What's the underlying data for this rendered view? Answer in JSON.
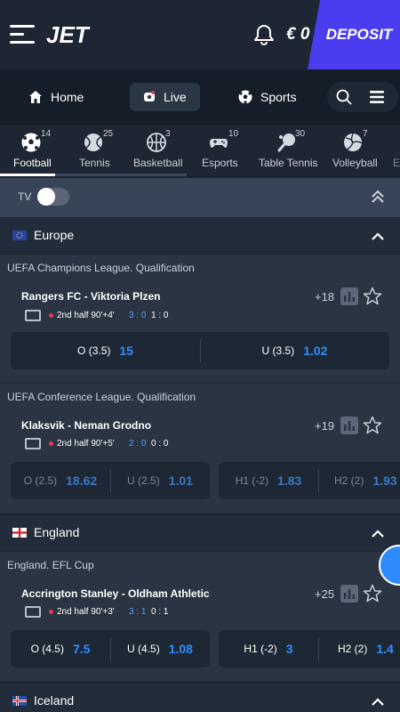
{
  "header": {
    "logo": "JET",
    "balance": "€ 0",
    "deposit": "DEPOSIT"
  },
  "nav": {
    "home": "Home",
    "live": "Live",
    "sports": "Sports"
  },
  "sports": [
    {
      "label": "Football",
      "count": "14",
      "icon": "football-icon"
    },
    {
      "label": "Tennis",
      "count": "25",
      "icon": "tennis-icon"
    },
    {
      "label": "Basketball",
      "count": "3",
      "icon": "basketball-icon"
    },
    {
      "label": "Esports",
      "count": "10",
      "icon": "gamepad-icon"
    },
    {
      "label": "Table Tennis",
      "count": "30",
      "icon": "table-tennis-icon"
    },
    {
      "label": "Volleyball",
      "count": "7",
      "icon": "volleyball-icon"
    },
    {
      "label": "E",
      "count": "",
      "icon": ""
    }
  ],
  "tv_label": "TV",
  "regions": [
    {
      "name": "Europe",
      "leagues": [
        {
          "name": "UEFA Champions League. Qualification",
          "match": {
            "teams": "Rangers FC - Viktoria Plzen",
            "more": "+18",
            "period": "2nd half  90'+4'",
            "score_live": "3 : 0",
            "score_half": "1 : 0",
            "odds": [
              {
                "k": "O (3.5)",
                "v": "15"
              },
              {
                "k": "U (3.5)",
                "v": "1.02"
              }
            ]
          }
        },
        {
          "name": "UEFA Conference League. Qualification",
          "match": {
            "teams": "Klaksvik - Neman Grodno",
            "more": "+19",
            "period": "2nd half  90'+5'",
            "score_live": "2 : 0",
            "score_half": "0 : 0",
            "odds": [
              {
                "k": "O (2.5)",
                "v": "18.62"
              },
              {
                "k": "U (2.5)",
                "v": "1.01"
              },
              {
                "k": "H1 (-2)",
                "v": "1.83"
              },
              {
                "k": "H2 (2)",
                "v": "1.93"
              }
            ]
          }
        }
      ]
    },
    {
      "name": "England",
      "leagues": [
        {
          "name": "England. EFL Cup",
          "match": {
            "teams": "Accrington Stanley - Oldham Athletic",
            "more": "+25",
            "period": "2nd half  90'+3'",
            "score_live": "3 : 1",
            "score_half": "0 : 1",
            "odds": [
              {
                "k": "O (4.5)",
                "v": "7.5"
              },
              {
                "k": "U (4.5)",
                "v": "1.08"
              },
              {
                "k": "H1 (-2)",
                "v": "3"
              },
              {
                "k": "H2 (2)",
                "v": "1.4"
              }
            ]
          }
        }
      ]
    },
    {
      "name": "Iceland",
      "leagues": []
    }
  ],
  "colors": {
    "accent": "#2f8cff",
    "deposit": "#4a3df0",
    "live_dot": "#e8395a"
  }
}
